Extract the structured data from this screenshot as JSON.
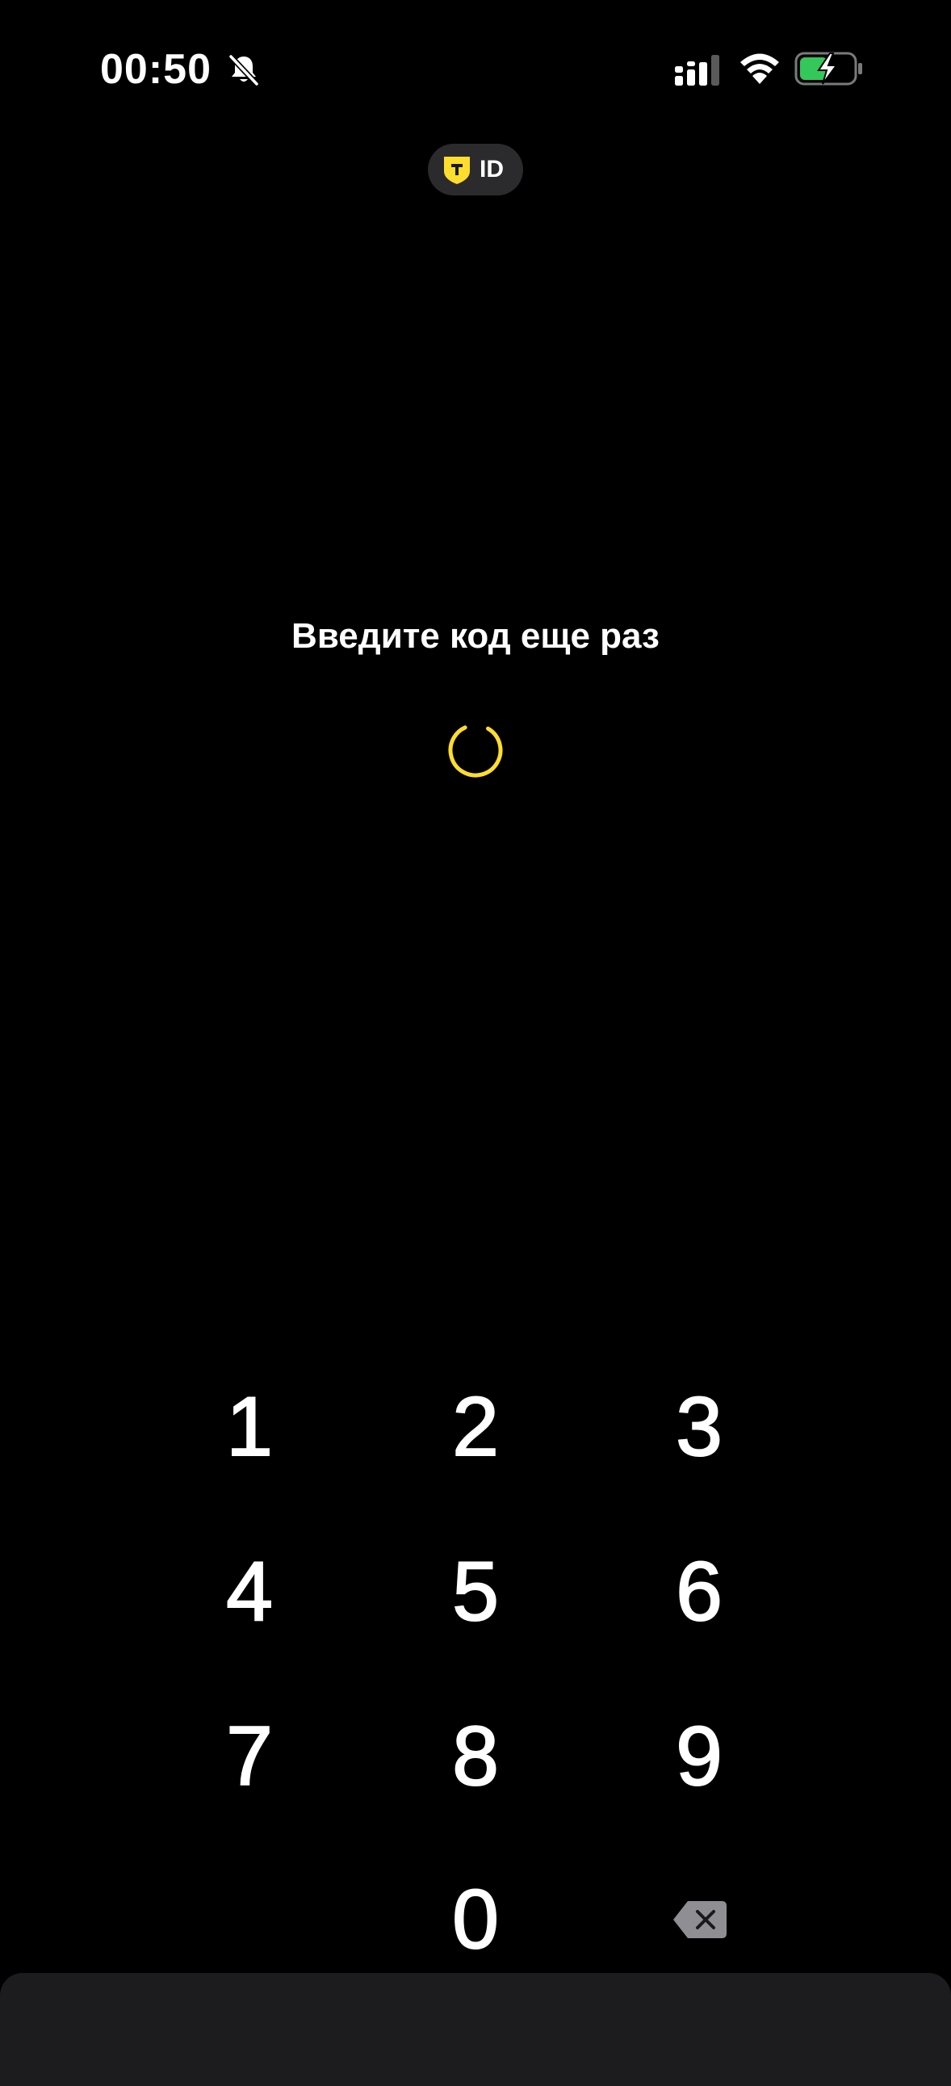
{
  "status_bar": {
    "time": "00:50",
    "icons": [
      "bell-slash-icon",
      "cellular-signal-icon",
      "wifi-icon",
      "battery-charging-icon"
    ]
  },
  "badge": {
    "label": "ID",
    "logo_letter": "T",
    "logo_color": "#ffdd2d"
  },
  "prompt": {
    "title": "Введите код еще раз"
  },
  "spinner": {
    "color": "#ffdd2d"
  },
  "keypad": {
    "keys": [
      "1",
      "2",
      "3",
      "4",
      "5",
      "6",
      "7",
      "8",
      "9",
      "0"
    ],
    "delete_icon": "backspace-icon"
  },
  "colors": {
    "background": "#000000",
    "accent": "#ffdd2d",
    "battery_fill": "#34c759",
    "sheet": "#1c1c1e"
  }
}
